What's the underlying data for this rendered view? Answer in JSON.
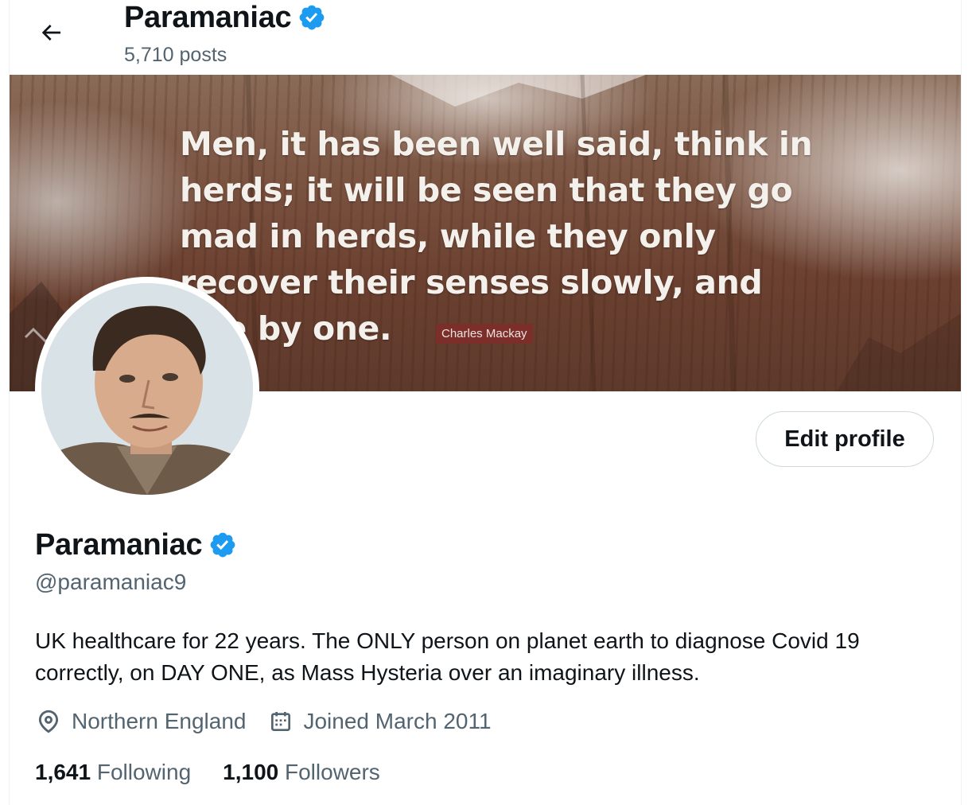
{
  "header": {
    "title": "Paramaniac",
    "posts_count": "5,710 posts"
  },
  "banner": {
    "quote": "Men, it has been well said, think in herds; it will be seen that they go mad in herds, while they only recover their senses slowly, and one by one.",
    "author": "Charles Mackay"
  },
  "actions": {
    "edit_profile_label": "Edit profile"
  },
  "profile": {
    "display_name": "Paramaniac",
    "handle": "@paramaniac9",
    "bio": "UK healthcare for 22 years. The ONLY person on planet earth to diagnose Covid 19 correctly, on DAY ONE, as Mass Hysteria over an imaginary illness.",
    "location": "Northern England",
    "joined": "Joined March 2011",
    "following_count": "1,641",
    "following_label": "Following",
    "followers_count": "1,100",
    "followers_label": "Followers",
    "verified": true
  },
  "colors": {
    "verified_badge": "#1d9bf0",
    "secondary_text": "#536471",
    "primary_text": "#0f1419",
    "quote_tag": "#7b2e2a"
  },
  "icons": [
    "back-arrow-icon",
    "verified-badge-icon",
    "location-pin-icon",
    "calendar-icon"
  ]
}
